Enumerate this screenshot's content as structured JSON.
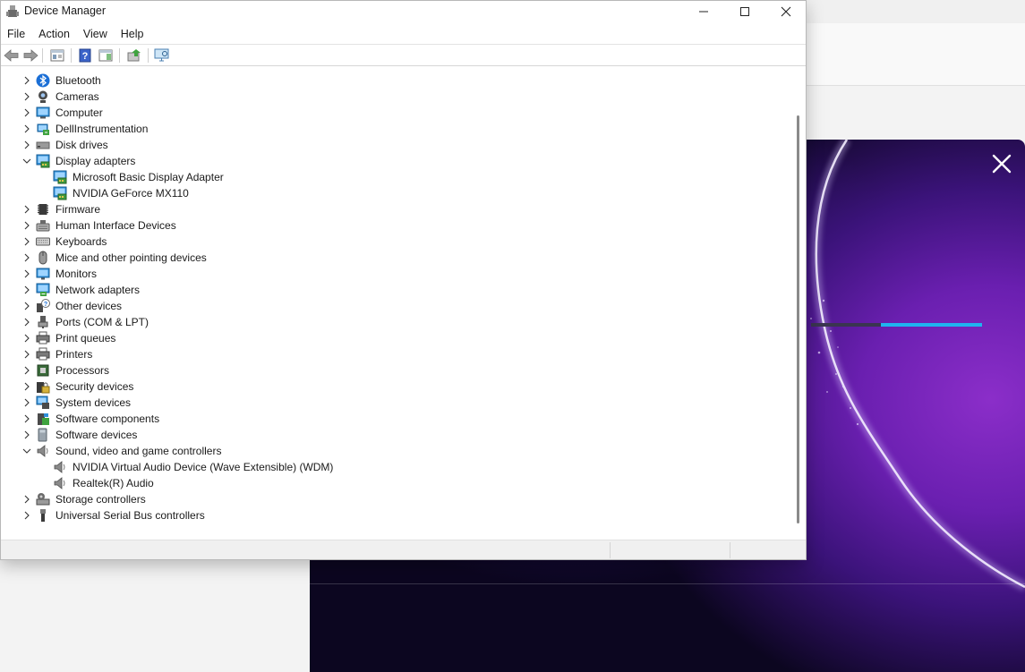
{
  "window": {
    "title": "Device Manager",
    "controls": {
      "minimize": "minimize-icon",
      "maximize": "maximize-icon",
      "close": "close-icon"
    }
  },
  "menu": [
    "File",
    "Action",
    "View",
    "Help"
  ],
  "toolbar": [
    "back-arrow-icon",
    "forward-arrow-icon",
    "properties-sheet-icon",
    "help-icon",
    "view-pane-icon",
    "update-driver-icon",
    "monitor-scan-icon"
  ],
  "tree": [
    {
      "label": "Bluetooth",
      "icon": "bluetooth-icon",
      "level": 0,
      "expanded": false
    },
    {
      "label": "Cameras",
      "icon": "camera-icon",
      "level": 0,
      "expanded": false
    },
    {
      "label": "Computer",
      "icon": "computer-icon",
      "level": 0,
      "expanded": false
    },
    {
      "label": "DellInstrumentation",
      "icon": "dell-instrumentation-icon",
      "level": 0,
      "expanded": false
    },
    {
      "label": "Disk drives",
      "icon": "disk-drive-icon",
      "level": 0,
      "expanded": false
    },
    {
      "label": "Display adapters",
      "icon": "display-adapter-icon",
      "level": 0,
      "expanded": true
    },
    {
      "label": "Microsoft Basic Display Adapter",
      "icon": "display-adapter-icon",
      "level": 1
    },
    {
      "label": "NVIDIA GeForce MX110",
      "icon": "display-adapter-icon",
      "level": 1
    },
    {
      "label": "Firmware",
      "icon": "firmware-chip-icon",
      "level": 0,
      "expanded": false
    },
    {
      "label": "Human Interface Devices",
      "icon": "hid-icon",
      "level": 0,
      "expanded": false
    },
    {
      "label": "Keyboards",
      "icon": "keyboard-icon",
      "level": 0,
      "expanded": false
    },
    {
      "label": "Mice and other pointing devices",
      "icon": "mouse-icon",
      "level": 0,
      "expanded": false
    },
    {
      "label": "Monitors",
      "icon": "monitor-icon",
      "level": 0,
      "expanded": false
    },
    {
      "label": "Network adapters",
      "icon": "network-adapter-icon",
      "level": 0,
      "expanded": false
    },
    {
      "label": "Other devices",
      "icon": "unknown-device-icon",
      "level": 0,
      "expanded": false
    },
    {
      "label": "Ports (COM & LPT)",
      "icon": "port-icon",
      "level": 0,
      "expanded": false
    },
    {
      "label": "Print queues",
      "icon": "printer-icon",
      "level": 0,
      "expanded": false
    },
    {
      "label": "Printers",
      "icon": "printer-icon",
      "level": 0,
      "expanded": false
    },
    {
      "label": "Processors",
      "icon": "processor-icon",
      "level": 0,
      "expanded": false
    },
    {
      "label": "Security devices",
      "icon": "security-device-icon",
      "level": 0,
      "expanded": false
    },
    {
      "label": "System devices",
      "icon": "system-device-icon",
      "level": 0,
      "expanded": false
    },
    {
      "label": "Software components",
      "icon": "software-component-icon",
      "level": 0,
      "expanded": false
    },
    {
      "label": "Software devices",
      "icon": "software-device-icon",
      "level": 0,
      "expanded": false
    },
    {
      "label": "Sound, video and game controllers",
      "icon": "speaker-icon",
      "level": 0,
      "expanded": true
    },
    {
      "label": "NVIDIA Virtual Audio Device (Wave Extensible) (WDM)",
      "icon": "speaker-icon",
      "level": 1
    },
    {
      "label": "Realtek(R) Audio",
      "icon": "speaker-icon",
      "level": 1
    },
    {
      "label": "Storage controllers",
      "icon": "storage-controller-icon",
      "level": 0,
      "expanded": false
    },
    {
      "label": "Universal Serial Bus controllers",
      "icon": "usb-icon",
      "level": 0,
      "expanded": false
    }
  ],
  "splash": {
    "close_icon": "close-icon",
    "progress": 0.59,
    "colors": {
      "progress_fill": "#1fb3f0",
      "progress_track": "#3a3550",
      "accent_purple": "#8b2ec9"
    }
  }
}
